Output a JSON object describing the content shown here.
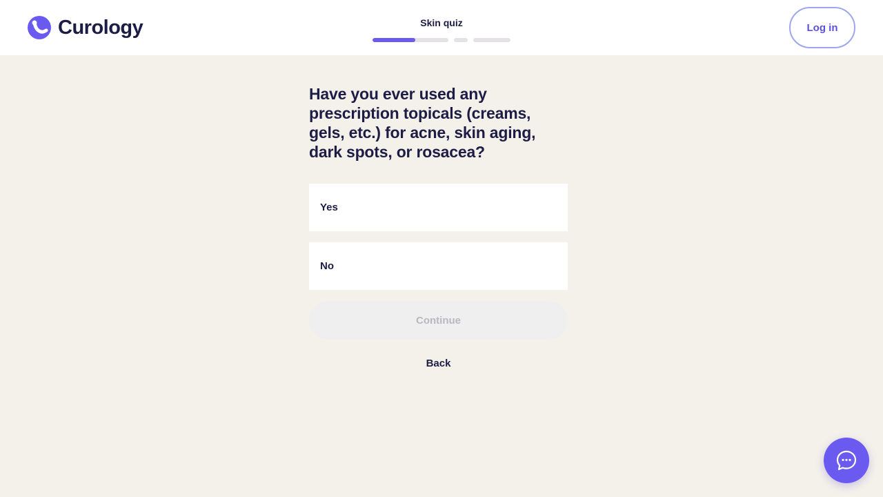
{
  "brand": {
    "name": "Curology",
    "logo_icon": "curology-logo-icon",
    "accent_color": "#6b5af0",
    "text_color": "#1c1c45"
  },
  "header": {
    "quiz_title": "Skin quiz",
    "progress": {
      "segments": [
        {
          "name": "segment-1",
          "fill": 0.56
        },
        {
          "name": "segment-2",
          "fill": 0
        },
        {
          "name": "segment-3",
          "fill": 0
        }
      ]
    },
    "login_label": "Log in"
  },
  "question": {
    "text": "Have you ever used any prescription topicals (creams, gels, etc.) for acne, skin aging, dark spots, or rosacea?",
    "options": [
      {
        "label": "Yes"
      },
      {
        "label": "No"
      }
    ]
  },
  "actions": {
    "continue_label": "Continue",
    "continue_disabled": true,
    "back_label": "Back"
  },
  "chat": {
    "icon": "chat-bubble-icon"
  }
}
